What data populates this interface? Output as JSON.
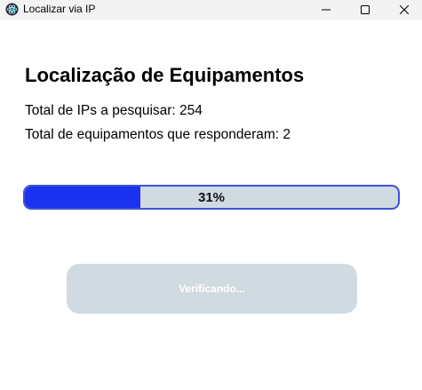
{
  "window": {
    "title": "Localizar via IP",
    "app_icon": "app-icon"
  },
  "controls": {
    "minimize_icon": "minimize-icon",
    "maximize_icon": "maximize-icon",
    "close_icon": "close-icon"
  },
  "main": {
    "heading": "Localização de Equipamentos",
    "total_ips_label": "Total de IPs a pesquisar: ",
    "total_ips_value": "254",
    "responded_label": "Total de equipamentos que responderam: ",
    "responded_value": "2"
  },
  "progress": {
    "value": 0.31,
    "label": "31%",
    "fill_color": "#1b33f0",
    "track_color": "#d0dae1",
    "border_color": "#3d53d6"
  },
  "action": {
    "button_label": "Verificando...",
    "disabled": true
  }
}
